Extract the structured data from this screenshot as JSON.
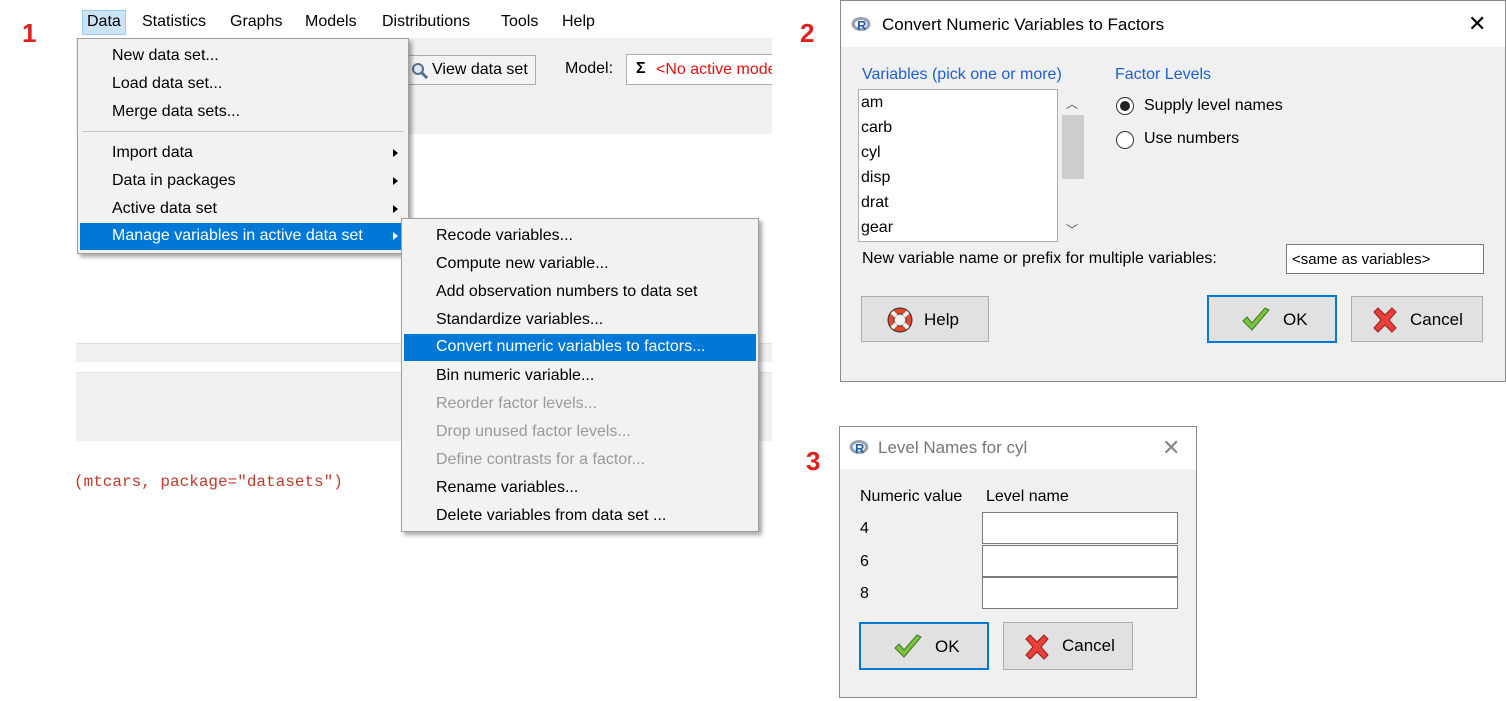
{
  "steps": [
    "1",
    "2",
    "3"
  ],
  "rcmdr": {
    "menubar": [
      "Data",
      "Statistics",
      "Graphs",
      "Models",
      "Distributions",
      "Tools",
      "Help"
    ],
    "view_data_set_button": "View data set",
    "model_label": "Model:",
    "model_sigma": "Σ",
    "model_value": "<No active model>",
    "code_line": "(mtcars, package=\"datasets\")",
    "data_menu": {
      "group1": [
        "New data set...",
        "Load data set...",
        "Merge data sets..."
      ],
      "group2": [
        "Import data",
        "Data in packages",
        "Active data set",
        "Manage variables in active data set"
      ]
    },
    "manage_submenu": [
      {
        "label": "Recode variables...",
        "disabled": false
      },
      {
        "label": "Compute new variable...",
        "disabled": false
      },
      {
        "label": "Add observation numbers to data set",
        "disabled": false
      },
      {
        "label": "Standardize variables...",
        "disabled": false
      },
      {
        "label": "Convert numeric variables to factors...",
        "disabled": false,
        "highlighted": true
      },
      {
        "label": "Bin numeric variable...",
        "disabled": false
      },
      {
        "label": "Reorder factor levels...",
        "disabled": true
      },
      {
        "label": "Drop unused factor levels...",
        "disabled": true
      },
      {
        "label": "Define contrasts for a factor...",
        "disabled": true
      },
      {
        "label": "Rename variables...",
        "disabled": false
      },
      {
        "label": "Delete variables from data set ...",
        "disabled": false
      }
    ]
  },
  "convert_dialog": {
    "title": "Convert Numeric Variables to Factors",
    "variables_label": "Variables (pick one or more)",
    "variables": [
      "am",
      "carb",
      "cyl",
      "disp",
      "drat",
      "gear"
    ],
    "factor_levels_label": "Factor Levels",
    "radio_supply": "Supply level names",
    "radio_numbers": "Use numbers",
    "radio_selected": "supply",
    "new_name_label": "New variable name or prefix for multiple variables:",
    "new_name_value": "<same as variables>",
    "help_button": "Help",
    "ok_button": "OK",
    "cancel_button": "Cancel"
  },
  "levels_dialog": {
    "title": "Level Names for cyl",
    "col_numeric": "Numeric value",
    "col_level": "Level name",
    "values": [
      "4",
      "6",
      "8"
    ],
    "level_names": [
      "",
      "",
      ""
    ],
    "ok_button": "OK",
    "cancel_button": "Cancel"
  },
  "colors": {
    "step": "#e0201c",
    "highlight": "#0078d7",
    "link_blue": "#1f5fd1",
    "error_red": "#e81010"
  }
}
